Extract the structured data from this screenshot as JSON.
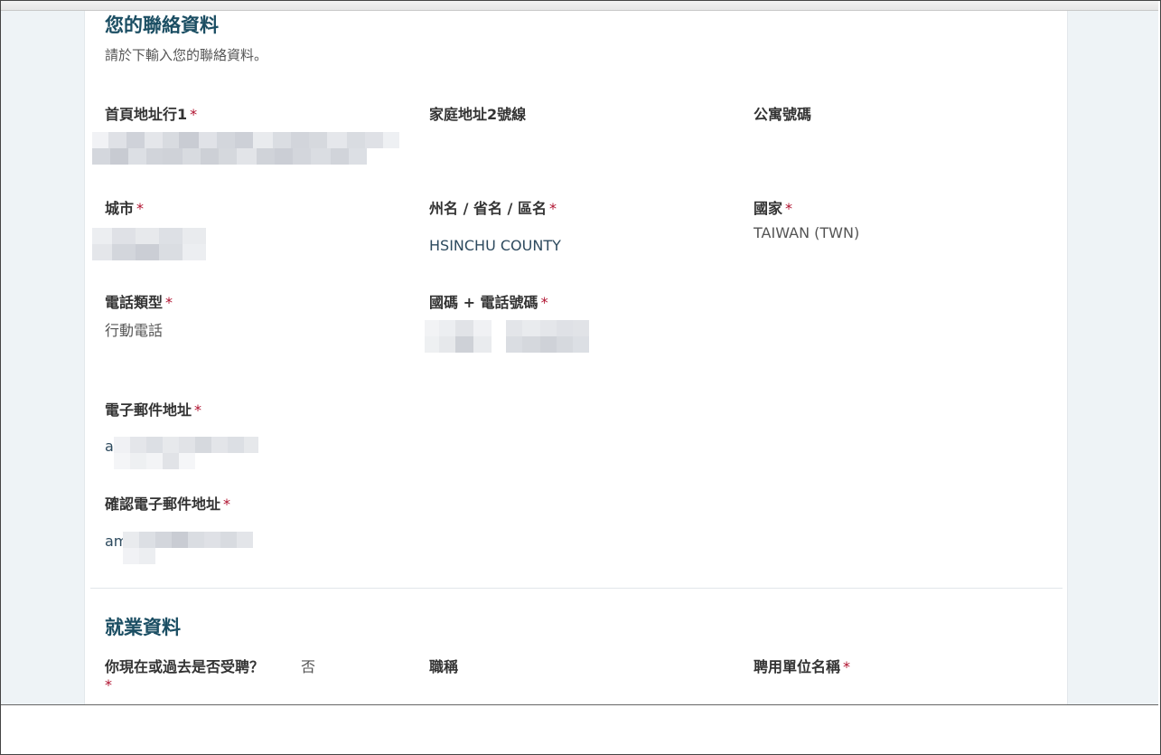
{
  "contact": {
    "title": "您的聯絡資料",
    "subtitle": "請於下輸入您的聯絡資料。",
    "required_mark": "*",
    "address1": {
      "label": "首頁地址行1",
      "required": true
    },
    "address2": {
      "label": "家庭地址2號線"
    },
    "apartment": {
      "label": "公寓號碼"
    },
    "city": {
      "label": "城市",
      "required": true
    },
    "state": {
      "label": "州名 / 省名 / 區名",
      "required": true,
      "value": "HSINCHU COUNTY"
    },
    "country": {
      "label": "國家",
      "required": true,
      "value": "TAIWAN (TWN)"
    },
    "phone_type": {
      "label": "電話類型",
      "required": true,
      "value": "行動電話"
    },
    "phone_number": {
      "label": "國碼 + 電話號碼",
      "required": true
    },
    "email": {
      "label": "電子郵件地址",
      "required": true,
      "value_prefix": "a"
    },
    "email_confirm": {
      "label": "確認電子郵件地址",
      "required": true,
      "value_prefix": "am"
    }
  },
  "employment": {
    "title": "就業資料",
    "employed": {
      "label": "你現在或過去是否受聘？",
      "required": true,
      "value": "否"
    },
    "job_title": {
      "label": "職稱"
    },
    "employer": {
      "label": "聘用單位名稱",
      "required": true
    }
  }
}
